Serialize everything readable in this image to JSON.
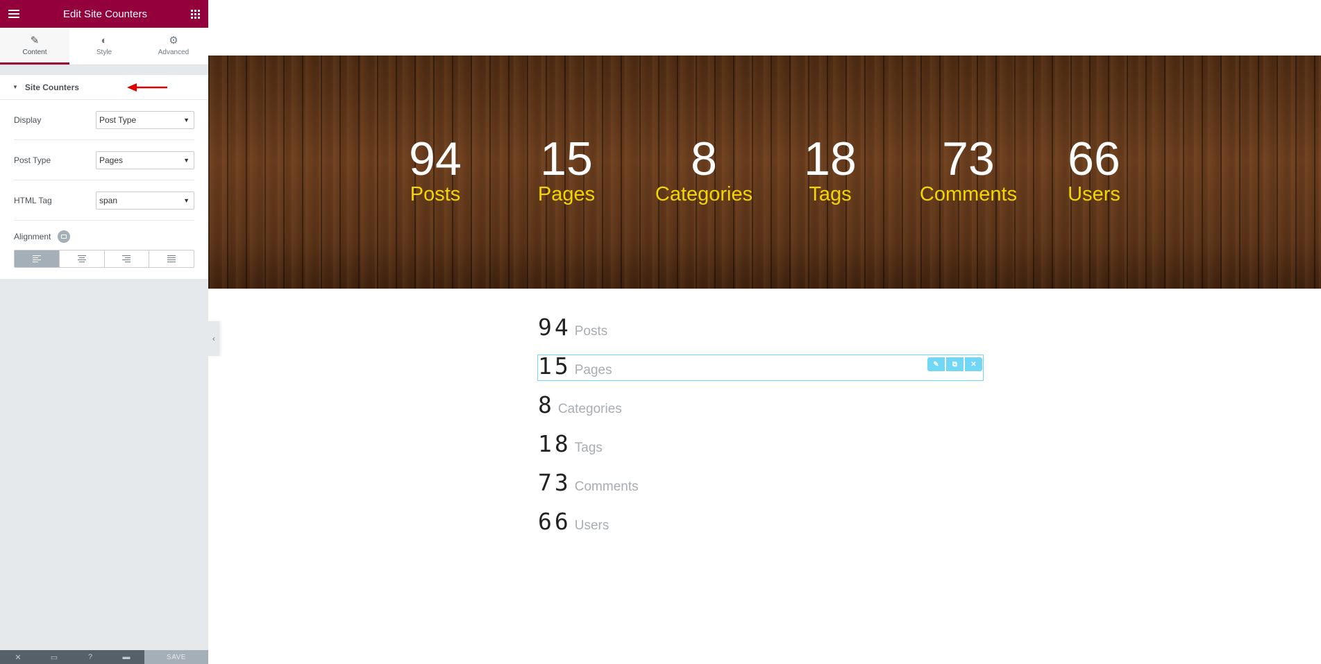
{
  "editor": {
    "title": "Edit Site Counters",
    "tabs": [
      {
        "label": "Content",
        "icon": "pencil-icon"
      },
      {
        "label": "Style",
        "icon": "contrast-icon"
      },
      {
        "label": "Advanced",
        "icon": "gear-icon"
      }
    ],
    "section_title": "Site Counters",
    "controls": {
      "display": {
        "label": "Display",
        "value": "Post Type"
      },
      "post_type": {
        "label": "Post Type",
        "value": "Pages"
      },
      "html_tag": {
        "label": "HTML Tag",
        "value": "span"
      },
      "alignment": {
        "label": "Alignment",
        "options": [
          "left",
          "center",
          "right",
          "justify"
        ],
        "selected": "left"
      }
    },
    "footer": {
      "save_label": "SAVE"
    },
    "accent_color": "#93003c"
  },
  "hero_counters": [
    {
      "number": "94",
      "label": "Posts"
    },
    {
      "number": "15",
      "label": "Pages"
    },
    {
      "number": "8",
      "label": "Categories"
    },
    {
      "number": "18",
      "label": "Tags"
    },
    {
      "number": "73",
      "label": "Comments"
    },
    {
      "number": "66",
      "label": "Users"
    }
  ],
  "list_counters": [
    {
      "number": "94",
      "label": "Posts"
    },
    {
      "number": "15",
      "label": "Pages"
    },
    {
      "number": "8",
      "label": "Categories"
    },
    {
      "number": "18",
      "label": "Tags"
    },
    {
      "number": "73",
      "label": "Comments"
    },
    {
      "number": "66",
      "label": "Users"
    }
  ],
  "colors": {
    "hero_label": "#f2d600",
    "selection": "#71d7f7"
  }
}
